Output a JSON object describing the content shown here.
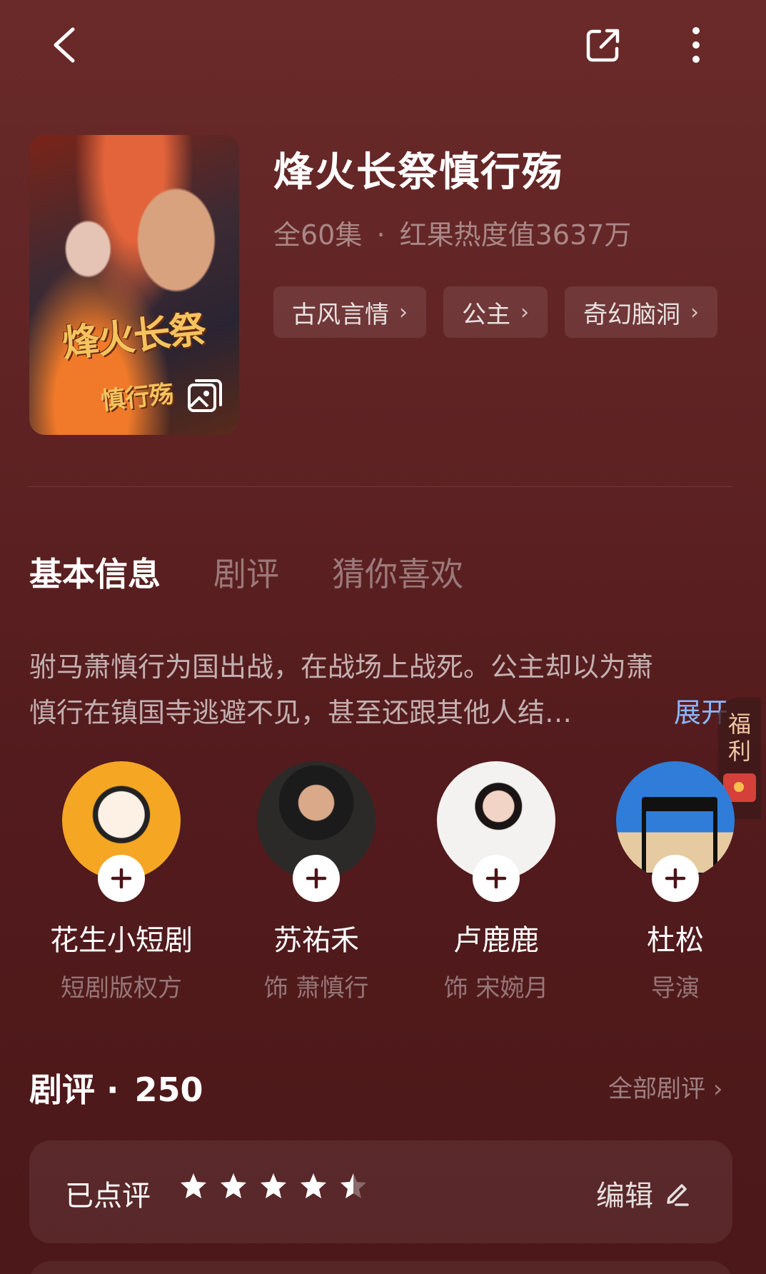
{
  "nav": {
    "back_icon": "chevron-left-icon",
    "share_icon": "share-icon",
    "more_icon": "more-vertical-icon"
  },
  "drama": {
    "title": "烽火长祭慎行殇",
    "episodes": "全60集",
    "separator": "·",
    "heat": "红果热度值3637万",
    "poster_title": "烽火长祭",
    "poster_subtitle": "慎行殇",
    "tags": [
      {
        "label": "古风言情"
      },
      {
        "label": "公主"
      },
      {
        "label": "奇幻脑洞"
      }
    ]
  },
  "tabs": [
    {
      "label": "基本信息",
      "active": true
    },
    {
      "label": "剧评",
      "active": false
    },
    {
      "label": "猜你喜欢",
      "active": false
    }
  ],
  "description": {
    "line1": "驸马萧慎行为国出战，在战场上战死。公主却以为萧",
    "line2": "慎行在镇国寺逃避不见，甚至还跟其他人结…",
    "expand": "展开"
  },
  "welfare": {
    "label": "福利"
  },
  "cast": [
    {
      "name": "花生小短剧",
      "role": "短剧版权方"
    },
    {
      "name": "苏祐禾",
      "role": "饰 萧慎行"
    },
    {
      "name": "卢鹿鹿",
      "role": "饰 宋婉月"
    },
    {
      "name": "杜松",
      "role": "导演"
    }
  ],
  "reviews": {
    "title": "剧评",
    "dot": "·",
    "count": "250",
    "all_label": "全部剧评",
    "rated_label": "已点评",
    "rating": 4.5,
    "rating_max": 5,
    "edit_label": "编辑"
  },
  "colors": {
    "accent_link": "#8ab6ff",
    "background": "#5e2223",
    "star": "#ffffff"
  }
}
